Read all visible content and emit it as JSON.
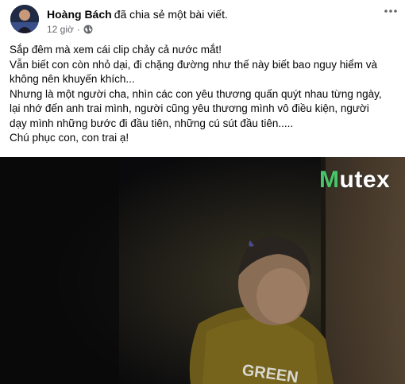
{
  "post": {
    "author": "Hoàng Bách",
    "action": "đã chia sẻ một bài viết.",
    "time": "12 giờ",
    "separator": "·",
    "privacy_icon": "globe-icon",
    "more_icon": "more-horizontal-icon"
  },
  "body": {
    "lines": [
      "Sắp đêm mà xem cái clip chảy cả nước mắt!",
      "Vẫn biết con còn nhỏ dại, đi chặng đường như thế này biết bao nguy hiểm và",
      "không nên khuyến khích...",
      "Nhưng là một người cha, nhìn các con yêu thương quấn quýt nhau từng ngày,",
      "lại nhớ đến anh trai mình, người cũng yêu thương mình vô điều kiện, người",
      "dạy mình những bước đi đầu tiên, những cú sút đầu tiên.....",
      "Chú phục con, con trai ạ!"
    ]
  },
  "media": {
    "watermark_first": "M",
    "watermark_rest": "utex",
    "shirt_text": "GREEN"
  },
  "colors": {
    "text": "#050505",
    "secondary": "#65676b",
    "watermark_accent": "#47c76a"
  }
}
